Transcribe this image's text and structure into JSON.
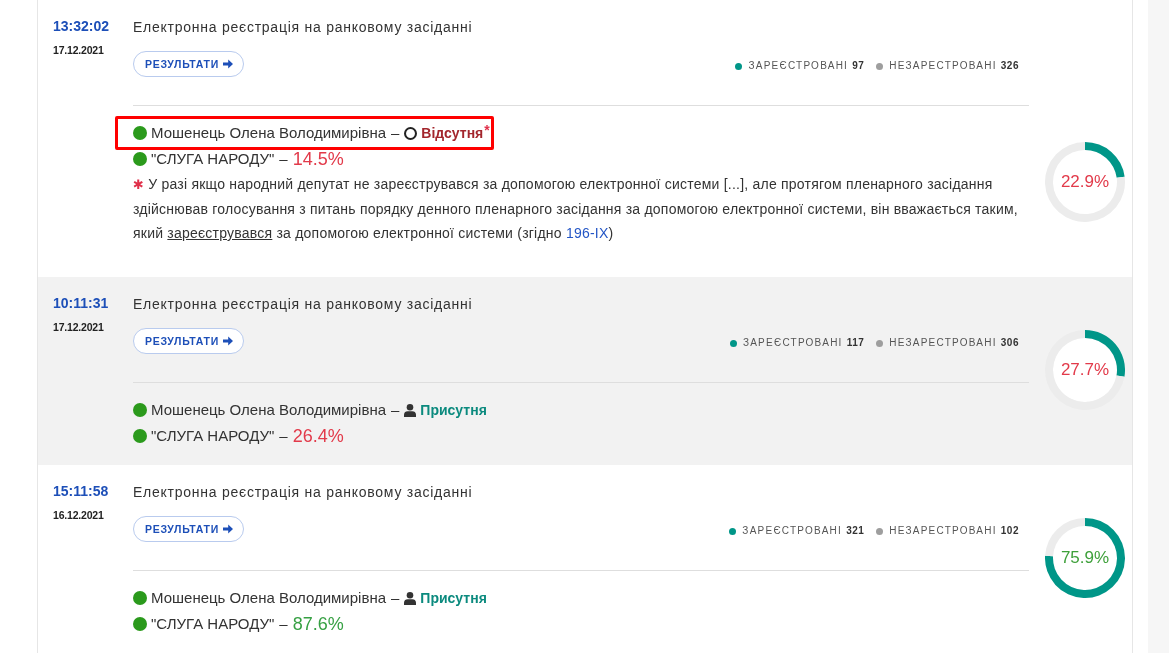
{
  "entries": [
    {
      "time": "13:32:02",
      "date": "17.12.2021",
      "title": "Електронна реєстрація на ранковому засіданні",
      "button": {
        "label": "РЕЗУЛЬТАТИ"
      },
      "legend": [
        {
          "label": "ЗАРЕЄСТРОВАНІ",
          "count": "97",
          "color": "#009688"
        },
        {
          "label": "НЕЗАРЕСТРОВАНІ",
          "count": "326",
          "color": "#9e9e9e"
        }
      ],
      "member": {
        "name": "Мошенець Олена Володимирівна",
        "separator": "–",
        "highlighted": true,
        "status": {
          "kind": "absent",
          "label": "Відсутня",
          "mark": "*"
        }
      },
      "party": {
        "name": "\"СЛУГА НАРОДУ\"",
        "separator": "–",
        "share": "14.5%",
        "color": "#e23a4a"
      },
      "note": {
        "mark": "✱",
        "parts": [
          {
            "kind": "text",
            "text": "У разі якщо народний депутат не зареєструвався за допомогою електронної системи [...], але протягом пленарного засідання здійснював голосування з питань порядку денного пленарного засідання за допомогою електронної системи, він вважається таким, який "
          },
          {
            "kind": "term",
            "text": "зареєструвався"
          },
          {
            "kind": "text",
            "text": " за допомогою електронної системи (згідно "
          },
          {
            "kind": "link",
            "text": "196-IX"
          },
          {
            "kind": "text",
            "text": ")"
          }
        ]
      },
      "ring": {
        "reading": "22.9%",
        "color": "#e23a4a",
        "chart_data": {
          "type": "donut",
          "values": [
            22.9,
            77.1
          ]
        }
      }
    },
    {
      "time": "10:11:31",
      "date": "17.12.2021",
      "title": "Електронна реєстрація на ранковому засіданні",
      "button": {
        "label": "РЕЗУЛЬТАТИ"
      },
      "legend": [
        {
          "label": "ЗАРЕЄСТРОВАНІ",
          "count": "117",
          "color": "#009688"
        },
        {
          "label": "НЕЗАРЕСТРОВАНІ",
          "count": "306",
          "color": "#9e9e9e"
        }
      ],
      "member": {
        "name": "Мошенець Олена Володимирівна",
        "separator": "–",
        "highlighted": false,
        "status": {
          "kind": "present",
          "label": "Присутня"
        }
      },
      "party": {
        "name": "\"СЛУГА НАРОДУ\"",
        "separator": "–",
        "share": "26.4%",
        "color": "#e23a4a"
      },
      "ring": {
        "reading": "27.7%",
        "color": "#e23a4a",
        "chart_data": {
          "type": "donut",
          "values": [
            27.7,
            72.3
          ]
        }
      }
    },
    {
      "time": "15:11:58",
      "date": "16.12.2021",
      "title": "Електронна реєстрація на ранковому засіданні",
      "button": {
        "label": "РЕЗУЛЬТАТИ"
      },
      "legend": [
        {
          "label": "ЗАРЕЄСТРОВАНІ",
          "count": "321",
          "color": "#009688"
        },
        {
          "label": "НЕЗАРЕСТРОВАНІ",
          "count": "102",
          "color": "#9e9e9e"
        }
      ],
      "member": {
        "name": "Мошенець Олена Володимирівна",
        "separator": "–",
        "highlighted": false,
        "status": {
          "kind": "present",
          "label": "Присутня"
        }
      },
      "party": {
        "name": "\"СЛУГА НАРОДУ\"",
        "separator": "–",
        "share": "87.6%",
        "color": "#36a043"
      },
      "ring": {
        "reading": "75.9%",
        "color": "#3ea03a",
        "chart_data": {
          "type": "donut",
          "values": [
            75.9,
            24.1
          ]
        }
      }
    }
  ]
}
